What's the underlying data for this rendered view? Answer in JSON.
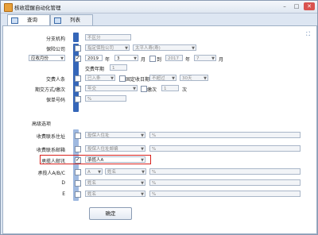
{
  "window": {
    "title": "核收提醒自动化管理",
    "controls": [
      "–",
      "□",
      "✕"
    ]
  },
  "tabs": [
    {
      "label": "查询"
    },
    {
      "label": "列表"
    }
  ],
  "form": {
    "branch": {
      "label": "分支机构",
      "value": "不区分"
    },
    "insurer": {
      "label": "保险公司",
      "value1": "指定保险公司",
      "value2": "太平人寿(寿)"
    },
    "due_month": {
      "select": "应收月份",
      "year": "2019",
      "year_unit": "年",
      "month": "3",
      "month_unit": "月",
      "to": "到",
      "year2": "2017",
      "month2": "7"
    },
    "pay_period": {
      "label": "交费年期",
      "value": "1"
    },
    "renew_person": {
      "label": "交费人条",
      "value": "已入条",
      "chk_label": "固定收日期",
      "value2": "不超过",
      "value3": "30天"
    },
    "period_freq": {
      "label": "期交方式/缴次",
      "value": "年交",
      "mid": "缴次",
      "value2": "1",
      "unit": "次"
    },
    "policy_no": {
      "label": "保单号码",
      "value": "%"
    }
  },
  "advanced": {
    "title": "高级选项",
    "address": {
      "label": "收费联系住址",
      "value": "投保人住址",
      "pct": "%"
    },
    "email": {
      "label": "收费联系邮箱",
      "value": "投保人住址邮编",
      "pct": "%"
    },
    "notifier": {
      "label": "承揽人邮讯",
      "value": "承揽人A"
    },
    "notifier_abc": {
      "label": "承揽人A/B/C",
      "v1": "A",
      "v2": "姓名",
      "pct": "%"
    },
    "d": {
      "label": "D",
      "v": "姓名",
      "pct": "%"
    },
    "e": {
      "label": "E",
      "v": "姓名",
      "pct": "%"
    }
  },
  "buttons": {
    "ok": "确定"
  }
}
